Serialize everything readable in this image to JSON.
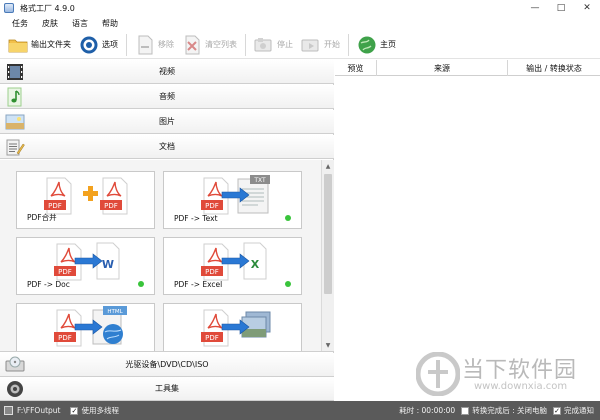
{
  "window": {
    "title": "格式工厂 4.9.0",
    "minimize": "—",
    "maximize": "□",
    "close": "✕"
  },
  "menu": [
    "任务",
    "皮肤",
    "语言",
    "帮助"
  ],
  "toolbar": {
    "output_folder": "输出文件夹",
    "options": "选项",
    "remove": "移除",
    "clear_list": "清空列表",
    "stop": "停止",
    "start": "开始",
    "home": "主页"
  },
  "categories": {
    "video": "视频",
    "audio": "音频",
    "image": "图片",
    "document": "文档",
    "disc": "光驱设备\\DVD\\CD\\ISO",
    "tools": "工具集"
  },
  "tiles": [
    {
      "label": "PDF合并",
      "dot": false
    },
    {
      "label": "PDF -> Text",
      "dot": true
    },
    {
      "label": "PDF -> Doc",
      "dot": true
    },
    {
      "label": "PDF -> Excel",
      "dot": true
    },
    {
      "label": "",
      "dot": false
    },
    {
      "label": "",
      "dot": false
    }
  ],
  "tile_icons": {
    "pdf": "PDF",
    "txt": "TXT",
    "word": "W",
    "excel": "X",
    "html": "HTML"
  },
  "columns": {
    "preview": "预览",
    "source": "来源",
    "output": "输出 / 转换状态"
  },
  "status": {
    "output_path": "F:\\FFOutput",
    "multithread": "使用多线程",
    "elapsed": "耗时 : 00:00:00",
    "after_convert": "转换完成后 : 关闭电脑",
    "notify": "完成通知"
  },
  "watermark": {
    "text": "当下软件园",
    "url": "www.downxia.com"
  }
}
